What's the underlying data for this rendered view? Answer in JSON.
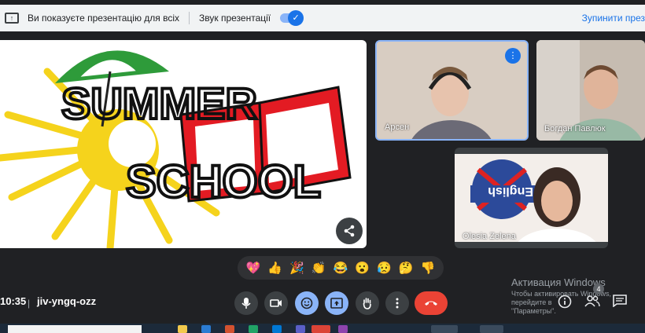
{
  "topbar": {
    "presenting_msg": "Ви показуєте презентацію для всіх",
    "sound_label": "Звук презентації",
    "sound_on": true,
    "stop_label": "Зупинити през"
  },
  "slide": {
    "title_line1": "SUMMER",
    "title_line2": "SCHOOL"
  },
  "participants": [
    {
      "name": "Арсен",
      "speaking": true
    },
    {
      "name": "Богдан Павлюк",
      "speaking": false
    },
    {
      "name": "Olesia Zelena",
      "speaking": false,
      "sign_text": "English"
    }
  ],
  "reactions": [
    "💖",
    "👍",
    "🎉",
    "👏",
    "😂",
    "😮",
    "😥",
    "🤔",
    "👎"
  ],
  "meeting": {
    "time": "10:35",
    "separator": "|",
    "code": "jiv-yngq-ozz"
  },
  "controls": [
    {
      "name": "mic-button",
      "icon": "mic-icon"
    },
    {
      "name": "camera-button",
      "icon": "camera-icon"
    },
    {
      "name": "reactions-button",
      "icon": "smile-icon"
    },
    {
      "name": "present-button",
      "icon": "present-icon"
    },
    {
      "name": "raise-hand-button",
      "icon": "hand-icon"
    },
    {
      "name": "more-options-button",
      "icon": "more-vert-icon"
    },
    {
      "name": "leave-call-button",
      "icon": "hangup-icon"
    }
  ],
  "windows_activation": {
    "title": "Активация Windows",
    "line2": "Чтобы активировать Windows, перейдите в",
    "line3": "\"Параметры\"."
  },
  "people_count": "4",
  "colors": {
    "background": "#202124",
    "accent": "#8ab4f8",
    "leave": "#ea4335"
  }
}
